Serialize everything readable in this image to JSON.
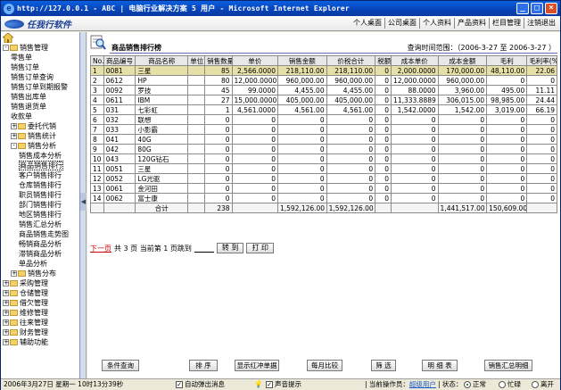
{
  "window": {
    "title": "http://127.0.0.1 - ABC | 电脑行业解决方案 5 用户 - Microsoft Internet Explorer",
    "minimize": "_",
    "maximize": "□",
    "close": "×"
  },
  "app": {
    "logo_text": "任我行软件",
    "top_nav": [
      "个人桌面",
      "公司桌面",
      "个人资料",
      "产品资料",
      "栏目管理",
      "注销退出"
    ]
  },
  "sidebar": {
    "nodes": [
      {
        "label": "销售管理",
        "level": 0,
        "expander": "-",
        "folder": true
      },
      {
        "label": "零售单",
        "level": 1
      },
      {
        "label": "销售订单",
        "level": 1
      },
      {
        "label": "销售订单查询",
        "level": 1
      },
      {
        "label": "销售订单到期报警",
        "level": 1
      },
      {
        "label": "销售出库单",
        "level": 1
      },
      {
        "label": "销售退货单",
        "level": 1
      },
      {
        "label": "收款单",
        "level": 1
      },
      {
        "label": "委托代销",
        "level": 1,
        "expander": "+",
        "folder": true
      },
      {
        "label": "销售统计",
        "level": 1,
        "expander": "+",
        "folder": true
      },
      {
        "label": "销售分析",
        "level": 1,
        "expander": "-",
        "folder": true
      },
      {
        "label": "销售成本分析",
        "level": 2
      },
      {
        "label": "商品销售排行",
        "level": 2,
        "selected": true
      },
      {
        "label": "客户销售排行",
        "level": 2
      },
      {
        "label": "仓库销售排行",
        "level": 2
      },
      {
        "label": "职员销售排行",
        "level": 2
      },
      {
        "label": "部门销售排行",
        "level": 2
      },
      {
        "label": "地区销售排行",
        "level": 2
      },
      {
        "label": "销售汇总分析",
        "level": 2
      },
      {
        "label": "商品销售走势图",
        "level": 2
      },
      {
        "label": "畅销商品分析",
        "level": 2
      },
      {
        "label": "滞销商品分析",
        "level": 2
      },
      {
        "label": "单品分析",
        "level": 2
      },
      {
        "label": "销售分布",
        "level": 1,
        "expander": "+",
        "folder": true
      },
      {
        "label": "采购管理",
        "level": 0,
        "expander": "+",
        "folder": true
      },
      {
        "label": "仓储管理",
        "level": 0,
        "expander": "+",
        "folder": true
      },
      {
        "label": "借欠管理",
        "level": 0,
        "expander": "+",
        "folder": true
      },
      {
        "label": "维修管理",
        "level": 0,
        "expander": "+",
        "folder": true
      },
      {
        "label": "往来管理",
        "level": 0,
        "expander": "+",
        "folder": true
      },
      {
        "label": "财务管理",
        "level": 0,
        "expander": "+",
        "folder": true
      },
      {
        "label": "辅助功能",
        "level": 0,
        "expander": "+",
        "folder": true
      }
    ]
  },
  "report": {
    "title": "商品销售排行榜",
    "query_range": "查询时间范围：（2006-3-27 至 2006-3-27 ）",
    "columns": [
      "No.",
      "商品编号",
      "商品名称",
      "单位",
      "销售数量",
      "单价",
      "销售金额",
      "价税合计",
      "税额",
      "成本单价",
      "成本金额",
      "毛利",
      "毛利率(%)"
    ],
    "rows": [
      [
        "1",
        "0081",
        "三星",
        "",
        "85",
        "2,566.0000",
        "218,110.00",
        "218,110.00",
        "0",
        "2,000.0000",
        "170,000.00",
        "48,110.00",
        "22.06"
      ],
      [
        "2",
        "0612",
        "HP",
        "",
        "80",
        "12,000.0000",
        "960,000.00",
        "960,000.00",
        "0",
        "12,000.0000",
        "960,000.00",
        "0",
        "0"
      ],
      [
        "3",
        "0092",
        "罗技",
        "",
        "45",
        "99.0000",
        "4,455.00",
        "4,455.00",
        "0",
        "88.0000",
        "3,960.00",
        "495.00",
        "11.11"
      ],
      [
        "4",
        "0611",
        "IBM",
        "",
        "27",
        "15,000.0000",
        "405,000.00",
        "405,000.00",
        "0",
        "11,333.8889",
        "306,015.00",
        "98,985.00",
        "24.44"
      ],
      [
        "5",
        "031",
        "七彩虹",
        "",
        "1",
        "4,561.0000",
        "4,561.00",
        "4,561.00",
        "0",
        "1,542.0000",
        "1,542.00",
        "3,019.00",
        "66.19"
      ],
      [
        "6",
        "032",
        "联想",
        "",
        "0",
        "0",
        "0",
        "0",
        "0",
        "0",
        "0",
        "0",
        "0"
      ],
      [
        "7",
        "033",
        "小影霸",
        "",
        "0",
        "0",
        "0",
        "0",
        "0",
        "0",
        "0",
        "0",
        "0"
      ],
      [
        "8",
        "041",
        "40G",
        "",
        "0",
        "0",
        "0",
        "0",
        "0",
        "0",
        "0",
        "0",
        "0"
      ],
      [
        "9",
        "042",
        "80G",
        "",
        "0",
        "0",
        "0",
        "0",
        "0",
        "0",
        "0",
        "0",
        "0"
      ],
      [
        "10",
        "043",
        "120G钻石",
        "",
        "0",
        "0",
        "0",
        "0",
        "0",
        "0",
        "0",
        "0",
        "0"
      ],
      [
        "11",
        "0051",
        "三星",
        "",
        "0",
        "0",
        "0",
        "0",
        "0",
        "0",
        "0",
        "0",
        "0"
      ],
      [
        "12",
        "0052",
        "LG光驱",
        "",
        "0",
        "0",
        "0",
        "0",
        "0",
        "0",
        "0",
        "0",
        "0"
      ],
      [
        "13",
        "0061",
        "金河田",
        "",
        "0",
        "0",
        "0",
        "0",
        "0",
        "0",
        "0",
        "0",
        "0"
      ],
      [
        "14",
        "0062",
        "富士康",
        "",
        "0",
        "0",
        "0",
        "0",
        "0",
        "0",
        "0",
        "0",
        "0"
      ]
    ],
    "total": [
      "",
      "",
      "合计",
      "",
      "238",
      "",
      "1,592,126.00",
      "1,592,126.00",
      "",
      "",
      "1,441,517.00",
      "150,609.00",
      ""
    ],
    "highlight_color": "#e6e0a8"
  },
  "pager": {
    "next": "下一页",
    "info": "共 3 页 当前第 1 页跳到",
    "goto_button": "转 到",
    "print_button": "打 印"
  },
  "actions": [
    "条件查询",
    "排  序",
    "显示红冲单据",
    "每月比较",
    "筛  选",
    "明 细 表",
    "销售汇总明细"
  ],
  "status": {
    "datetime": "2006年3月27日 星期一 10时13分39秒",
    "popup_label": "自动弹出消息",
    "sound_label": "声音提示",
    "operator_prefix": "| 当前操作员：",
    "operator": "超级用户",
    "state_prefix": "| 状态：",
    "states": [
      "正常",
      "忙碌",
      "离开"
    ]
  }
}
